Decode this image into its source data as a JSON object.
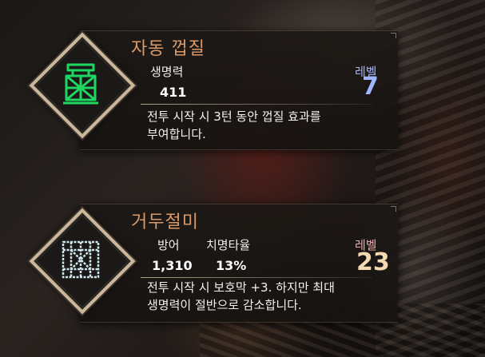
{
  "skills": [
    {
      "name": "자동 껍질",
      "stats": [
        {
          "label": "생명력",
          "value": "411"
        }
      ],
      "level_label": "레벨",
      "level": "7",
      "level_color": "#9fb4ff",
      "description_lines": [
        "전투 시작 시 3턴 동안 껍질 효과를",
        "부여합니다."
      ],
      "icon": "green-tower-rune-icon",
      "icon_color": "#1ed760"
    },
    {
      "name": "거두절미",
      "stats": [
        {
          "label": "방어",
          "value": "1,310"
        },
        {
          "label": "치명타율",
          "value": "13%"
        }
      ],
      "level_label": "레벨",
      "level": "23",
      "level_color": "#f4d9b0",
      "level_label_color": "#f0a6ad",
      "description_lines": [
        "전투 시작 시 보호막 +3. 하지만 최대",
        "생명력이 절반으로 감소합니다."
      ],
      "icon": "cage-rune-icon",
      "icon_color": "#cfe9ee"
    }
  ]
}
